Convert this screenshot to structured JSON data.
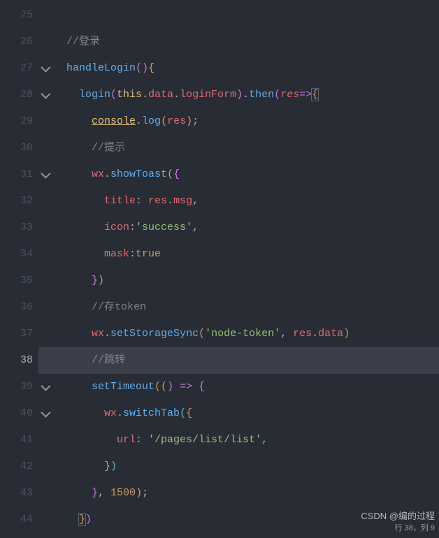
{
  "watermark": {
    "main": "CSDN @编的过程",
    "sub": "行 38，列 9"
  },
  "highlight_line": 38,
  "lines": [
    {
      "n": 25,
      "fold": false,
      "tokens": []
    },
    {
      "n": 26,
      "fold": false,
      "tokens": [
        {
          "t": "  ",
          "c": ""
        },
        {
          "t": "//登录",
          "c": "c-comment"
        }
      ]
    },
    {
      "n": 27,
      "fold": true,
      "tokens": [
        {
          "t": "  ",
          "c": ""
        },
        {
          "t": "handleLogin",
          "c": "c-call"
        },
        {
          "t": "()",
          "c": "c-brace2"
        },
        {
          "t": "{",
          "c": "c-brace"
        }
      ]
    },
    {
      "n": 28,
      "fold": true,
      "tokens": [
        {
          "t": "    ",
          "c": ""
        },
        {
          "t": "login",
          "c": "c-call"
        },
        {
          "t": "(",
          "c": "c-brace2"
        },
        {
          "t": "this",
          "c": "c-obj"
        },
        {
          "t": ".",
          "c": "c-punc"
        },
        {
          "t": "data",
          "c": "c-prop"
        },
        {
          "t": ".",
          "c": "c-punc"
        },
        {
          "t": "loginForm",
          "c": "c-prop"
        },
        {
          "t": ")",
          "c": "c-brace2"
        },
        {
          "t": ".",
          "c": "c-punc"
        },
        {
          "t": "then",
          "c": "c-call"
        },
        {
          "t": "(",
          "c": "c-brace2"
        },
        {
          "t": "res",
          "c": "c-param"
        },
        {
          "t": "=>",
          "c": "c-arrow"
        },
        {
          "t": "{",
          "c": "c-brace c-match"
        }
      ]
    },
    {
      "n": 29,
      "fold": false,
      "tokens": [
        {
          "t": "      ",
          "c": ""
        },
        {
          "t": "console",
          "c": "c-console"
        },
        {
          "t": ".",
          "c": "c-punc"
        },
        {
          "t": "log",
          "c": "c-call"
        },
        {
          "t": "(",
          "c": "c-brace"
        },
        {
          "t": "res",
          "c": "c-var"
        },
        {
          "t": ")",
          "c": "c-brace"
        },
        {
          "t": ";",
          "c": "c-punc"
        }
      ]
    },
    {
      "n": 30,
      "fold": false,
      "tokens": [
        {
          "t": "      ",
          "c": ""
        },
        {
          "t": "//提示",
          "c": "c-comment"
        }
      ]
    },
    {
      "n": 31,
      "fold": true,
      "tokens": [
        {
          "t": "      ",
          "c": ""
        },
        {
          "t": "wx",
          "c": "c-var"
        },
        {
          "t": ".",
          "c": "c-punc"
        },
        {
          "t": "showToast",
          "c": "c-call"
        },
        {
          "t": "(",
          "c": "c-brace"
        },
        {
          "t": "{",
          "c": "c-brace2"
        }
      ]
    },
    {
      "n": 32,
      "fold": false,
      "tokens": [
        {
          "t": "        ",
          "c": ""
        },
        {
          "t": "title",
          "c": "c-var"
        },
        {
          "t": ": ",
          "c": "c-punc"
        },
        {
          "t": "res",
          "c": "c-var"
        },
        {
          "t": ".",
          "c": "c-punc"
        },
        {
          "t": "msg",
          "c": "c-prop"
        },
        {
          "t": ",",
          "c": "c-punc"
        }
      ]
    },
    {
      "n": 33,
      "fold": false,
      "tokens": [
        {
          "t": "        ",
          "c": ""
        },
        {
          "t": "icon",
          "c": "c-var"
        },
        {
          "t": ":",
          "c": "c-punc"
        },
        {
          "t": "'success'",
          "c": "c-str"
        },
        {
          "t": ",",
          "c": "c-punc"
        }
      ]
    },
    {
      "n": 34,
      "fold": false,
      "tokens": [
        {
          "t": "        ",
          "c": ""
        },
        {
          "t": "mask",
          "c": "c-var"
        },
        {
          "t": ":",
          "c": "c-punc"
        },
        {
          "t": "true",
          "c": "c-bool"
        }
      ]
    },
    {
      "n": 35,
      "fold": false,
      "tokens": [
        {
          "t": "      ",
          "c": ""
        },
        {
          "t": "}",
          "c": "c-brace2"
        },
        {
          "t": ")",
          "c": "c-brace"
        }
      ]
    },
    {
      "n": 36,
      "fold": false,
      "tokens": [
        {
          "t": "      ",
          "c": ""
        },
        {
          "t": "//存token",
          "c": "c-comment"
        }
      ]
    },
    {
      "n": 37,
      "fold": false,
      "tokens": [
        {
          "t": "      ",
          "c": ""
        },
        {
          "t": "wx",
          "c": "c-var"
        },
        {
          "t": ".",
          "c": "c-punc"
        },
        {
          "t": "setStorageSync",
          "c": "c-call"
        },
        {
          "t": "(",
          "c": "c-brace"
        },
        {
          "t": "'node-token'",
          "c": "c-str"
        },
        {
          "t": ", ",
          "c": "c-punc"
        },
        {
          "t": "res",
          "c": "c-var"
        },
        {
          "t": ".",
          "c": "c-punc"
        },
        {
          "t": "data",
          "c": "c-prop"
        },
        {
          "t": ")",
          "c": "c-brace"
        }
      ]
    },
    {
      "n": 38,
      "fold": false,
      "tokens": [
        {
          "t": "      ",
          "c": ""
        },
        {
          "t": "//跳转",
          "c": "c-comment"
        }
      ]
    },
    {
      "n": 39,
      "fold": true,
      "tokens": [
        {
          "t": "      ",
          "c": ""
        },
        {
          "t": "setTimeout",
          "c": "c-call"
        },
        {
          "t": "((",
          "c": "c-brace"
        },
        {
          "t": ") ",
          "c": "c-brace2"
        },
        {
          "t": "=>",
          "c": "c-arrow"
        },
        {
          "t": " {",
          "c": "c-brace2"
        }
      ]
    },
    {
      "n": 40,
      "fold": true,
      "tokens": [
        {
          "t": "        ",
          "c": ""
        },
        {
          "t": "wx",
          "c": "c-var"
        },
        {
          "t": ".",
          "c": "c-punc"
        },
        {
          "t": "switchTab",
          "c": "c-call"
        },
        {
          "t": "(",
          "c": "c-brace3"
        },
        {
          "t": "{",
          "c": "c-brace"
        }
      ]
    },
    {
      "n": 41,
      "fold": false,
      "tokens": [
        {
          "t": "          ",
          "c": ""
        },
        {
          "t": "url",
          "c": "c-var"
        },
        {
          "t": ": ",
          "c": "c-punc"
        },
        {
          "t": "'/pages/list/list'",
          "c": "c-str"
        },
        {
          "t": ",",
          "c": "c-punc"
        }
      ]
    },
    {
      "n": 42,
      "fold": false,
      "tokens": [
        {
          "t": "        ",
          "c": ""
        },
        {
          "t": "}",
          "c": "c-brace"
        },
        {
          "t": ")",
          "c": "c-brace3"
        }
      ]
    },
    {
      "n": 43,
      "fold": false,
      "tokens": [
        {
          "t": "      ",
          "c": ""
        },
        {
          "t": "}",
          "c": "c-brace2"
        },
        {
          "t": ", ",
          "c": "c-punc"
        },
        {
          "t": "1500",
          "c": "c-num"
        },
        {
          "t": ")",
          "c": "c-brace"
        },
        {
          "t": ";",
          "c": "c-punc"
        }
      ]
    },
    {
      "n": 44,
      "fold": false,
      "tokens": [
        {
          "t": "    ",
          "c": ""
        },
        {
          "t": "}",
          "c": "c-brace c-match"
        },
        {
          "t": ")",
          "c": "c-brace2"
        }
      ]
    }
  ]
}
